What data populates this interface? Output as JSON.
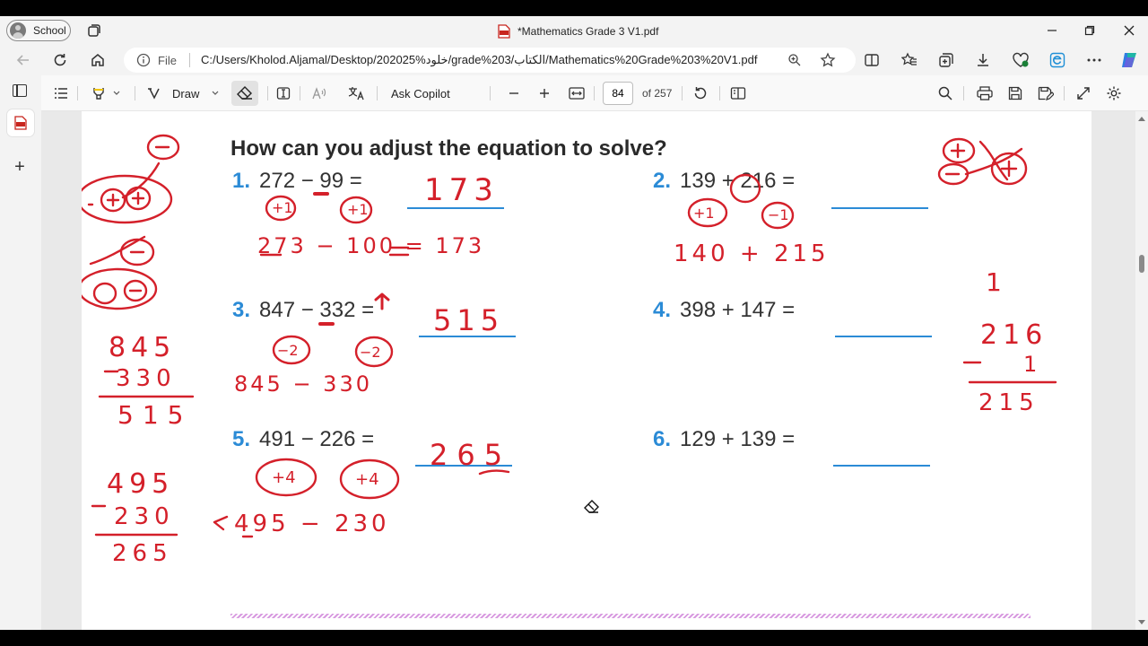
{
  "browser": {
    "profile_label": "School",
    "tab_title": "*Mathematics Grade 3 V1.pdf",
    "url_scheme": "File",
    "url": "C:/Users/Kholod.Aljamal/Desktop/202025%خلود/grade%203/الكتاب/Mathematics%20Grade%203%20V1.pdf"
  },
  "pdf_toolbar": {
    "draw_label": "Draw",
    "copilot_label": "Ask Copilot",
    "page_current": "84",
    "page_total": "of 257"
  },
  "page": {
    "title": "How can you adjust the equation to solve?",
    "problems": [
      {
        "n": "1.",
        "expr": "272 − 99 ="
      },
      {
        "n": "2.",
        "expr": "139 + 216 ="
      },
      {
        "n": "3.",
        "expr": "847 − 332 ="
      },
      {
        "n": "4.",
        "expr": "398 + 147 ="
      },
      {
        "n": "5.",
        "expr": "491 − 226 ="
      },
      {
        "n": "6.",
        "expr": "129 + 139 ="
      }
    ]
  },
  "handwriting": {
    "p1_answer": "173",
    "p1_adjust_a": "+1",
    "p1_adjust_b": "+1",
    "p1_rewrite": "273 − 100 = 173",
    "p2_adjust_a": "+1",
    "p2_adjust_b": "−1",
    "p2_rewrite": "140 + 215",
    "p3_answer": "515",
    "p3_adjust_a": "−2",
    "p3_adjust_b": "−2",
    "p3_rewrite": "845 − 330",
    "p5_answer": "265",
    "p5_adjust_a": "+4",
    "p5_adjust_b": "+4",
    "p5_rewrite": "495 − 230",
    "left_sub1_top": "845",
    "left_sub1_mid": "330",
    "left_sub1_res": "515",
    "left_sub2_top": "495",
    "left_sub2_mid": "230",
    "left_sub2_res": "265",
    "right_top": "1",
    "right_sub_top": "216",
    "right_sub_mid": "1",
    "right_sub_res": "215"
  },
  "colors": {
    "ink": "#d4202a",
    "number_blue": "#2b8bd6"
  }
}
